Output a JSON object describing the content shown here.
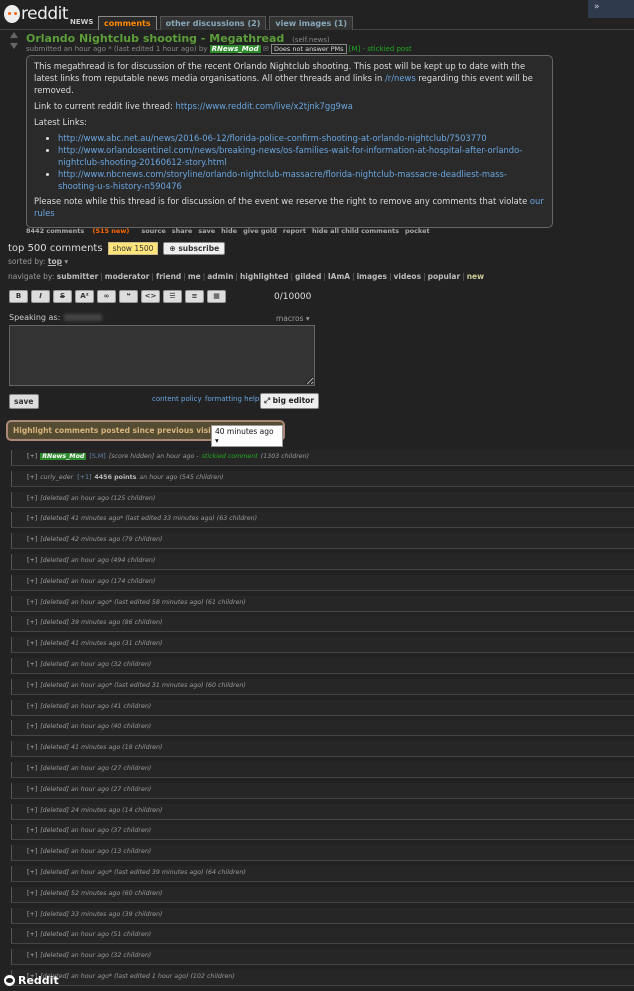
{
  "header": {
    "logo_text": "reddit",
    "subreddit": "NEWS",
    "tabs": [
      "comments",
      "other discussions (2)",
      "view images (1)"
    ],
    "collapse_label": "»"
  },
  "post": {
    "title": "Orlando Nightclub shooting - Megathread",
    "domain": "(self.news)",
    "tagline_prefix": "submitted an hour ago * (last edited 1 hour ago) by",
    "author": "RNews_Mod",
    "pm_badge": "Does not answer PMs",
    "mod_tag": "[M]",
    "stickied": "- stickied post",
    "para1_pre": "This megathread is for discussion of the recent Orlando Nightclub shooting. This post will be kept up to date with the latest links from reputable news media organisations. All other threads and links in ",
    "para1_link": "/r/news",
    "para1_post": " regarding this event will be removed.",
    "live_label": "Link to current reddit live thread: ",
    "live_link": "https://www.reddit.com/live/x2tjnk7gg9wa",
    "latest_links_label": "Latest Links:",
    "links": [
      "http://www.abc.net.au/news/2016-06-12/florida-police-confirm-shooting-at-orlando-nightclub/7503770",
      "http://www.orlandosentinel.com/news/breaking-news/os-families-wait-for-information-at-hospital-after-orlando-nightclub-shooting-20160612-story.html",
      "http://www.nbcnews.com/storyline/orlando-nightclub-massacre/florida-nightclub-massacre-deadliest-mass-shooting-u-s-history-n590476"
    ],
    "note_pre": "Please note while this thread is for discussion of the event we reserve the right to remove any comments that violate ",
    "note_link": "our rules",
    "buttons": {
      "comments": "8442 comments",
      "new": "(515 new)",
      "source": "source",
      "share": "share",
      "save": "save",
      "hide": "hide",
      "give_gold": "give gold",
      "report": "report",
      "hide_children": "hide all child comments",
      "pocket": "pocket"
    }
  },
  "comments_header": {
    "title": "top 500 comments",
    "show_label": "show 1500",
    "subscribe_label": "subscribe",
    "sorted_label": "sorted by:",
    "sorted_value": "top",
    "navigate_label": "navigate by:",
    "nav_items": [
      "submitter",
      "moderator",
      "friend",
      "me",
      "admin",
      "highlighted",
      "gilded",
      "IAmA",
      "images",
      "videos",
      "popular",
      "new"
    ]
  },
  "editor": {
    "tools": [
      "B",
      "I",
      "S",
      "A²",
      "∞",
      "❝",
      "<>",
      "☰",
      "≡",
      "▦"
    ],
    "char_count": "0/10000",
    "speaking_as": "Speaking as:",
    "macros": "macros ▾",
    "save_label": "save",
    "content_policy": "content policy",
    "formatting_help": "formatting help",
    "big_editor": "big editor"
  },
  "highlight": {
    "label": "Highlight comments posted since previous visit:",
    "value": "40 minutes ago ▾"
  },
  "comments": [
    {
      "type": "mod",
      "author": "RNews_Mod",
      "flair": "[S,M]",
      "text": "[score hidden] an hour ago -",
      "stickied": "stickied comment",
      "children": "(1303 children)"
    },
    {
      "type": "user",
      "author": "curly_eder",
      "flair": "[+1]",
      "score": "4456 points",
      "text": "an hour ago (545 children)"
    },
    {
      "type": "deleted",
      "text": "[deleted] an hour ago (125 children)"
    },
    {
      "type": "deleted",
      "text": "[deleted] 41 minutes ago* (last edited 33 minutes ago) (63 children)"
    },
    {
      "type": "deleted",
      "text": "[deleted] 42 minutes ago (79 children)"
    },
    {
      "type": "deleted",
      "text": "[deleted] an hour ago (494 children)"
    },
    {
      "type": "deleted",
      "text": "[deleted] an hour ago (174 children)"
    },
    {
      "type": "deleted",
      "text": "[deleted] an hour ago* (last edited 58 minutes ago) (61 children)"
    },
    {
      "type": "deleted",
      "text": "[deleted] 39 minutes ago (86 children)"
    },
    {
      "type": "deleted",
      "text": "[deleted] 41 minutes ago (31 children)"
    },
    {
      "type": "deleted",
      "text": "[deleted] an hour ago (32 children)"
    },
    {
      "type": "deleted",
      "text": "[deleted] an hour ago* (last edited 31 minutes ago) (60 children)"
    },
    {
      "type": "deleted",
      "text": "[deleted] an hour ago (41 children)"
    },
    {
      "type": "deleted",
      "text": "[deleted] an hour ago (40 children)"
    },
    {
      "type": "deleted",
      "text": "[deleted] 41 minutes ago (18 children)"
    },
    {
      "type": "deleted",
      "text": "[deleted] an hour ago (27 children)"
    },
    {
      "type": "deleted",
      "text": "[deleted] an hour ago (27 children)"
    },
    {
      "type": "deleted",
      "text": "[deleted] 24 minutes ago (14 children)"
    },
    {
      "type": "deleted",
      "text": "[deleted] an hour ago (37 children)"
    },
    {
      "type": "deleted",
      "text": "[deleted] an hour ago (13 children)"
    },
    {
      "type": "deleted",
      "text": "[deleted] an hour ago* (last edited 39 minutes ago) (64 children)"
    },
    {
      "type": "deleted",
      "text": "[deleted] 52 minutes ago (60 children)"
    },
    {
      "type": "deleted",
      "text": "[deleted] 33 minutes ago (39 children)"
    },
    {
      "type": "deleted",
      "text": "[deleted] an hour ago (51 children)"
    },
    {
      "type": "deleted",
      "text": "[deleted] an hour ago (32 children)"
    },
    {
      "type": "deleted",
      "text": "[deleted] an hour ago* (last edited 1 hour ago) (102 children)"
    }
  ],
  "expand_label": "[+]",
  "watermark": "Reddit"
}
